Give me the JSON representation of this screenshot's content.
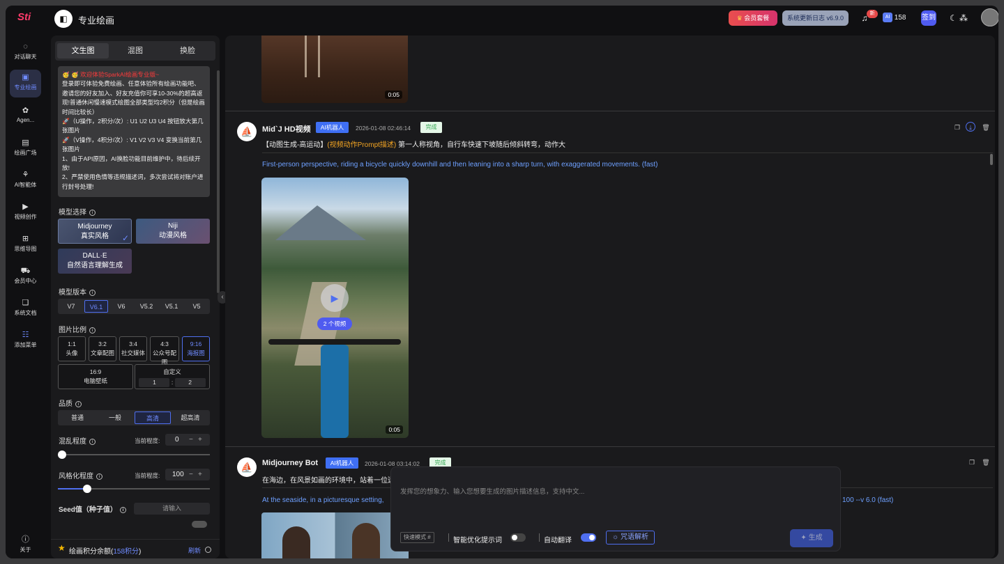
{
  "nav": {
    "logo": "Sti",
    "items": [
      {
        "label": "对话聊天",
        "icon": "chat-icon"
      },
      {
        "label": "专业绘画",
        "icon": "painting-icon"
      },
      {
        "label": "Agen...",
        "icon": "agent-icon"
      },
      {
        "label": "绘画广场",
        "icon": "gallery-icon"
      },
      {
        "label": "AI智能体",
        "icon": "ai-agent-icon"
      },
      {
        "label": "视频创作",
        "icon": "video-icon"
      },
      {
        "label": "思维导图",
        "icon": "mindmap-icon"
      },
      {
        "label": "会员中心",
        "icon": "cart-icon"
      },
      {
        "label": "系统文档",
        "icon": "docs-icon"
      },
      {
        "label": "添加菜单",
        "icon": "menu-add-icon"
      }
    ],
    "about": "关于"
  },
  "header": {
    "title": "专业绘画",
    "vip": "会员套餐",
    "changelog": "系统更新日志 v6.9.0",
    "notify_badge": "新",
    "points": "158",
    "checkin": "签到",
    "accent": "#3f6ff3"
  },
  "panel": {
    "tabs": [
      "文生图",
      "混图",
      "换脸"
    ],
    "notice": {
      "headline": "🥳 🥳 欢迎体验SparkAI绘画专业版~",
      "lines": [
        "登录即可体验免费绘画、任意体验所有绘画功能吧、邀请您的好友加入、好友充值你可享10-30%的超高返现!普通休闲慢速模式绘图全部类型均2积分（但是绘画时间比较长）",
        "🚀（U操作，2积分/次）: U1 U2 U3 U4 按钮放大第几张图片",
        "🚀（V操作，4积分/次）: V1 V2 V3 V4 变换当前第几张图片",
        "1、由于API原因，AI换脸功能目前维护中，待后续开放!",
        "2、严禁使用色情等违规描述词，多次尝试将对账户进行封号处理!"
      ]
    },
    "model_label": "模型选择",
    "models": [
      {
        "name": "Midjourney",
        "sub": "真实风格"
      },
      {
        "name": "Niji",
        "sub": "动漫风格"
      },
      {
        "name": "DALL·E",
        "sub": "自然语言理解生成"
      }
    ],
    "version_label": "模型版本",
    "versions": [
      "V7",
      "V6.1",
      "V6",
      "V5.2",
      "V5.1",
      "V5"
    ],
    "ratio_label": "图片比例",
    "ratios": [
      {
        "r": "1:1",
        "d": "头像"
      },
      {
        "r": "3:2",
        "d": "文章配图"
      },
      {
        "r": "3:4",
        "d": "社交媒体"
      },
      {
        "r": "4:3",
        "d": "公众号配图"
      },
      {
        "r": "9:16",
        "d": "海报图"
      }
    ],
    "ratio_wide": {
      "r": "16:9",
      "d": "电脑壁纸"
    },
    "custom": {
      "label": "自定义",
      "w": "1",
      "sep": ":",
      "h": "2"
    },
    "quality_label": "品质",
    "qualities": [
      "普通",
      "一般",
      "高清",
      "超高清"
    ],
    "chaos_label": "混乱程度",
    "current_label": "当前程度:",
    "chaos_value": "0",
    "chaos_level": 0,
    "stylize_label": "风格化程度",
    "stylize_value": "100",
    "stylize_level": 0.1,
    "seed_label": "Seed值（种子值）",
    "seed_placeholder": "请输入",
    "footer_prefix": "绘画积分余额(",
    "footer_points": "158积分",
    "footer_suffix": ")",
    "refresh": "刷新"
  },
  "messages": [
    {
      "bot": "Mid`J HD视频",
      "tag": "AI机器人",
      "time": "2026-01-08 02:46:14",
      "status": "完成",
      "prompt_prefix": "【动图生成-高运动】",
      "prompt_tag": "(视频动作Prompt描述)",
      "prompt_text": "第一人称视角，自行车快速下坡随后倾斜转弯，动作大",
      "english": "First-person perspective, riding a bicycle quickly downhill and then leaning into a sharp turn, with exaggerated movements.  (fast)",
      "video_count": "2 个视频",
      "duration": "0:05"
    },
    {
      "bot": "Midjourney Bot",
      "tag": "AI机器人",
      "time": "2026-01-08 03:14:02",
      "status": "完成",
      "prompt_text": "在海边，在风景如画的环境中，站着一位迷",
      "english_start": "At the seaside, in a picturesque setting,",
      "english_end": "100 --v 6.0  (fast)"
    }
  ],
  "prev_duration": "0:05",
  "composer": {
    "placeholder": "发挥您的想象力、输入您想要生成的图片描述信息，支持中文...",
    "mode": "快速模式 #",
    "optimize": "智能优化提示词",
    "translate": "自动翻译",
    "analyze": "咒语解析",
    "generate": "生成"
  }
}
